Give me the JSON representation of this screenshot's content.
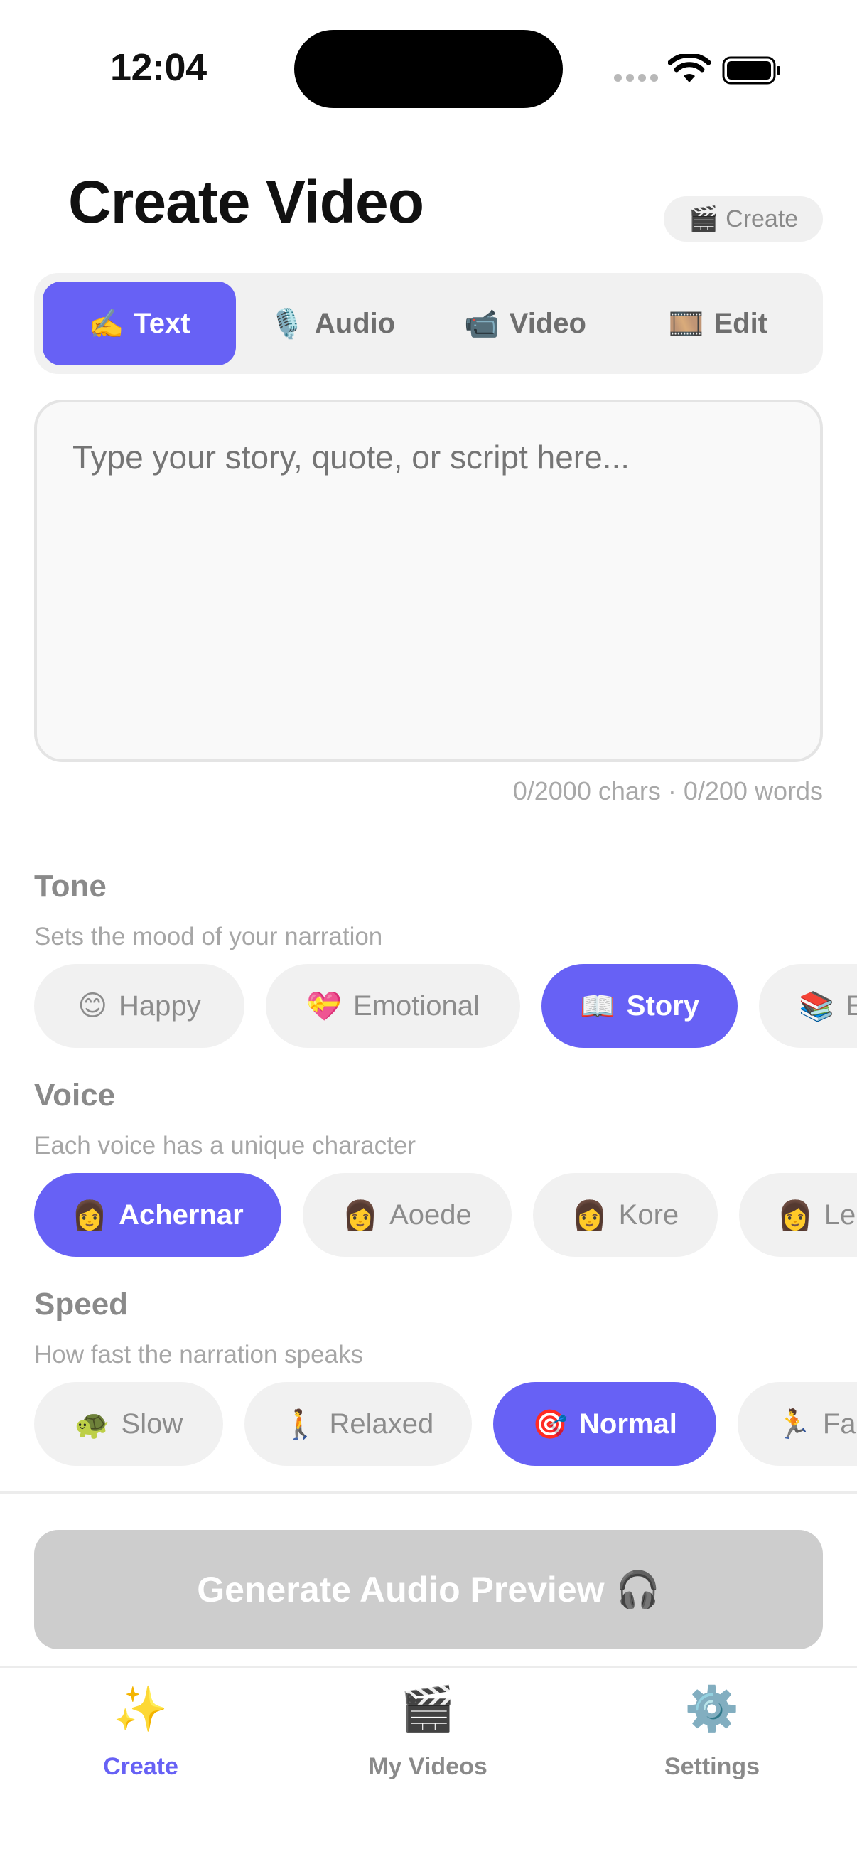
{
  "status_bar": {
    "time": "12:04"
  },
  "header": {
    "title": "Create Video",
    "badge_icon": "🎬",
    "badge_label": "Create"
  },
  "tabs": [
    {
      "icon": "✍️",
      "label": "Text",
      "active": true
    },
    {
      "icon": "🎙️",
      "label": "Audio",
      "active": false
    },
    {
      "icon": "📹",
      "label": "Video",
      "active": false
    },
    {
      "icon": "🎞️",
      "label": "Edit",
      "active": false
    }
  ],
  "story_input": {
    "placeholder": "Type your story, quote, or script here...",
    "value": ""
  },
  "counter": "0/2000 chars · 0/200 words",
  "tone": {
    "title": "Tone",
    "subtitle": "Sets the mood of your narration",
    "options": [
      {
        "icon": "😊",
        "label": "Happy",
        "active": false
      },
      {
        "icon": "💝",
        "label": "Emotional",
        "active": false
      },
      {
        "icon": "📖",
        "label": "Story",
        "active": true
      },
      {
        "icon": "📚",
        "label": "E",
        "active": false
      }
    ]
  },
  "voice": {
    "title": "Voice",
    "subtitle": "Each voice has a unique character",
    "options": [
      {
        "icon": "👩",
        "label": "Achernar",
        "active": true
      },
      {
        "icon": "👩",
        "label": "Aoede",
        "active": false
      },
      {
        "icon": "👩",
        "label": "Kore",
        "active": false
      },
      {
        "icon": "👩",
        "label": "Le",
        "active": false
      }
    ]
  },
  "speed": {
    "title": "Speed",
    "subtitle": "How fast the narration speaks",
    "options": [
      {
        "icon": "🐢",
        "label": "Slow",
        "active": false
      },
      {
        "icon": "🚶",
        "label": "Relaxed",
        "active": false
      },
      {
        "icon": "🎯",
        "label": "Normal",
        "active": true
      },
      {
        "icon": "🏃",
        "label": "Fas",
        "active": false
      }
    ]
  },
  "generate_button": {
    "label": "Generate Audio Preview",
    "icon": "🎧"
  },
  "bottom_nav": [
    {
      "icon": "✨",
      "label": "Create",
      "active": true
    },
    {
      "icon": "🎬",
      "label": "My Videos",
      "active": false
    },
    {
      "icon": "⚙️",
      "label": "Settings",
      "active": false
    }
  ],
  "colors": {
    "accent": "#6761f5",
    "chip_bg": "#f1f1f1",
    "button_disabled": "#cdcdcd"
  }
}
